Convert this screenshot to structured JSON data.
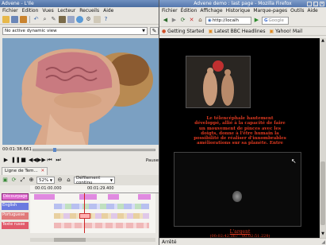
{
  "advene": {
    "title": "Advene - L'Ile",
    "menu": [
      "Fichier",
      "Edition",
      "Vues",
      "Lecteur",
      "Recueils",
      "Aide"
    ],
    "dynamic_view": "No active dynamic view",
    "time_current": "00:01:38.661",
    "pause_label": "Pause",
    "timeline_tab": "Ligne de Tem...",
    "zoom": "52%",
    "scroll_mode": "Défilement continu",
    "ruler_labels": [
      "00:01:00.000",
      "00:01:29.400"
    ],
    "tracks": [
      "Décourpage",
      "English",
      "Portuguese",
      "Texte russe"
    ],
    "accent": "#ef6fb0"
  },
  "firefox": {
    "title": "Advene demo : last page - Mozilla Firefox",
    "menu": [
      "Fichier",
      "Édition",
      "Affichage",
      "Historique",
      "Marque-pages",
      "Outils",
      "Aide"
    ],
    "url": "http://localh",
    "search_placeholder": "Google",
    "bookmarks": [
      "Getting Started",
      "Latest BBC Headlines",
      "Yahoo! Mail"
    ],
    "caption_lines": [
      "Le télencéphale hautement",
      "développé, allié à la capacité de faire",
      "un mouvement de pinces avec les",
      "doigts, donne à l'être humain la",
      "possibilité de réaliser d'innombrables",
      "améliorations sur sa planète. Entre"
    ],
    "money_label": "L'argent",
    "money_time": "(00:02:42.367 - 00:02:51.228)",
    "status": "Arrêté",
    "text_color": "#e03a20"
  }
}
